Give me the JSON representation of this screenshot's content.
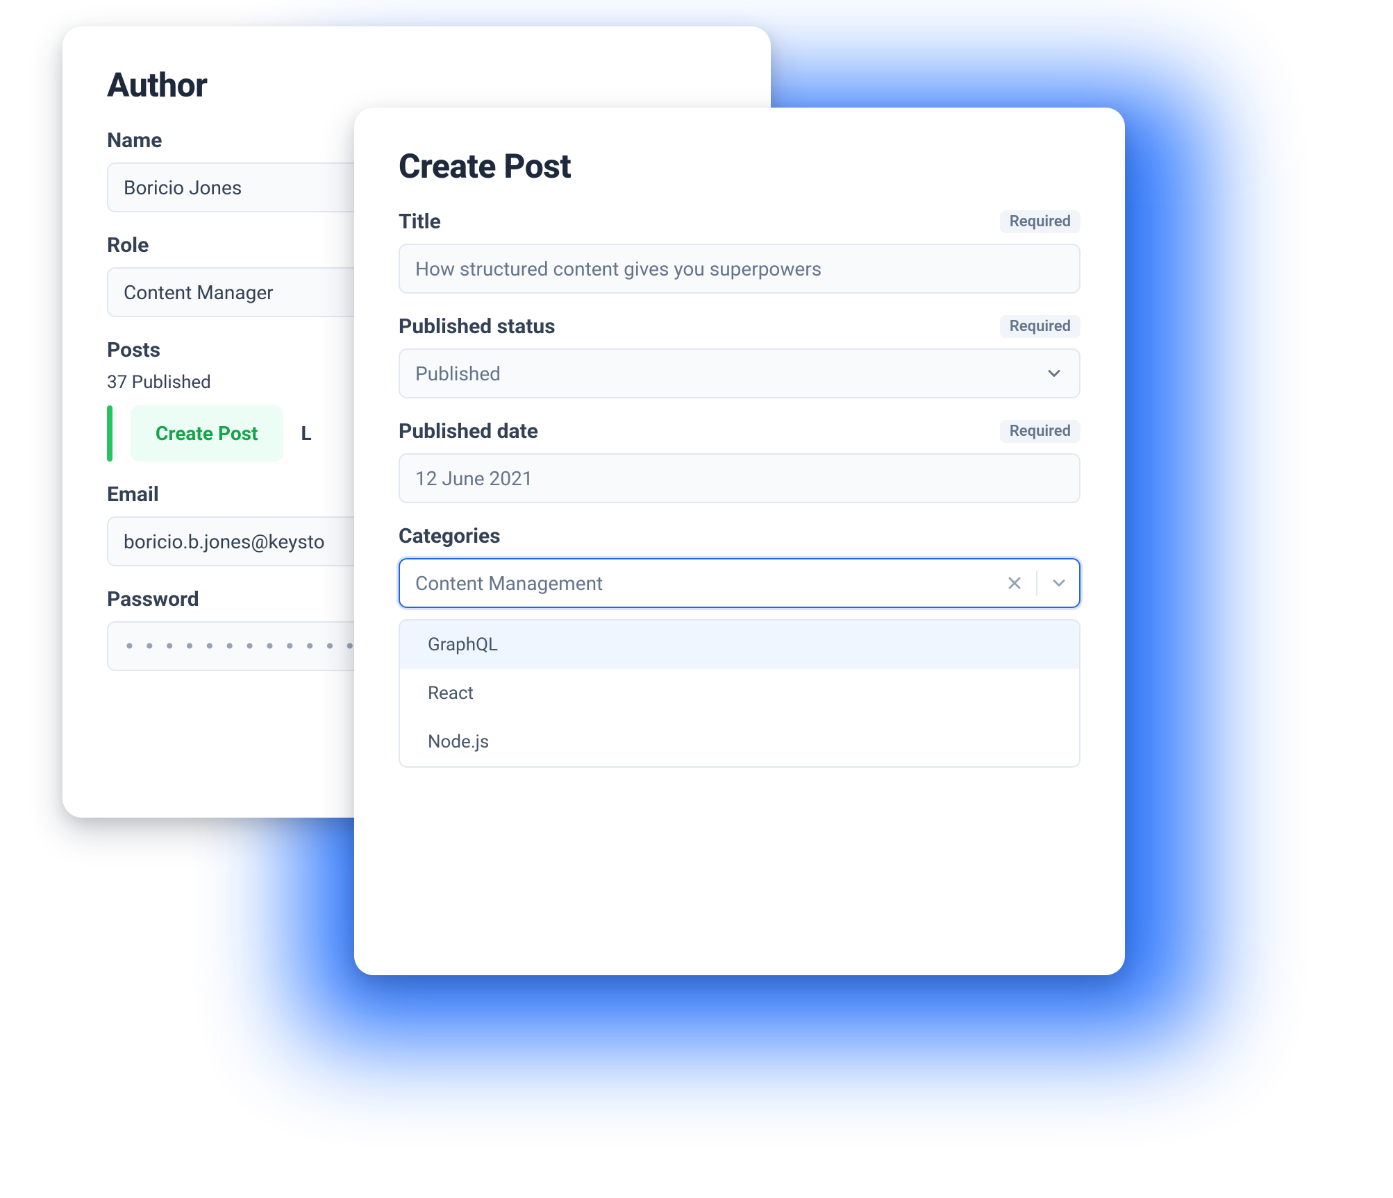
{
  "author_card": {
    "title": "Author",
    "name": {
      "label": "Name",
      "value": "Boricio Jones"
    },
    "role": {
      "label": "Role",
      "value": "Content Manager"
    },
    "posts": {
      "label": "Posts",
      "meta": "37 Published",
      "create_button": "Create Post",
      "trailing": "L"
    },
    "email": {
      "label": "Email",
      "value": "boricio.b.jones@keysto"
    },
    "password": {
      "label": "Password",
      "mask": "••••••••••••••••••••••••••••••"
    }
  },
  "post_card": {
    "title": "Create Post",
    "required_label": "Required",
    "fields": {
      "title": {
        "label": "Title",
        "placeholder": "How structured content gives you superpowers"
      },
      "published_status": {
        "label": "Published status",
        "value": "Published"
      },
      "published_date": {
        "label": "Published date",
        "value": "12 June 2021"
      },
      "categories": {
        "label": "Categories",
        "value": "Content Management",
        "options": [
          "GraphQL",
          "React",
          "Node.js"
        ]
      }
    }
  }
}
